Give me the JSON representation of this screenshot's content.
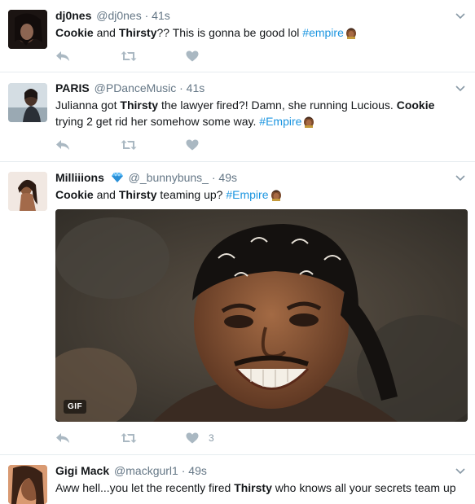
{
  "tweets": [
    {
      "fullname": "dj0nes",
      "handle": "@dj0nes",
      "dot": "·",
      "time": "41s",
      "text": [
        {
          "t": "Cookie",
          "b": true
        },
        {
          "t": " and "
        },
        {
          "t": "Thirsty",
          "b": true
        },
        {
          "t": "?? This is gonna be good lol "
        },
        {
          "t": "#empire",
          "tag": true
        }
      ]
    },
    {
      "fullname": "PARIS",
      "handle": "@PDanceMusic",
      "dot": "·",
      "time": "41s",
      "text": [
        {
          "t": "Julianna got "
        },
        {
          "t": "Thirsty",
          "b": true
        },
        {
          "t": " the lawyer fired?! Damn, she running Lucious. "
        },
        {
          "t": "Cookie",
          "b": true
        },
        {
          "t": " trying 2 get rid her somehow some way. "
        },
        {
          "t": "#Empire",
          "tag": true
        }
      ]
    },
    {
      "fullname": "Milliiions",
      "handle": "@_bunnybuns_",
      "dot": "·",
      "time": "49s",
      "text": [
        {
          "t": "Cookie",
          "b": true
        },
        {
          "t": " and "
        },
        {
          "t": "Thirsty",
          "b": true
        },
        {
          "t": " teaming up?  "
        },
        {
          "t": "#Empire",
          "tag": true
        }
      ],
      "media_badge": "GIF",
      "like_count": "3"
    },
    {
      "fullname": "Gigi Mack",
      "handle": "@mackgurl1",
      "dot": "·",
      "time": "49s",
      "text": [
        {
          "t": "Aww hell...you let the recently fired "
        },
        {
          "t": "Thirsty",
          "b": true
        },
        {
          "t": " who knows all your secrets team up"
        }
      ]
    }
  ],
  "icons": {
    "reply": "reply-icon",
    "retweet": "retweet-icon",
    "like": "heart-icon",
    "menu": "chevron-down-icon",
    "emoji": "empire-hashflag-emoji",
    "verified": "blue-diamond-emoji"
  },
  "colors": {
    "hashtag": "#1b95e0",
    "meta": "#657786",
    "action_icon": "#aab8c2",
    "divider": "#e6ecf0"
  }
}
